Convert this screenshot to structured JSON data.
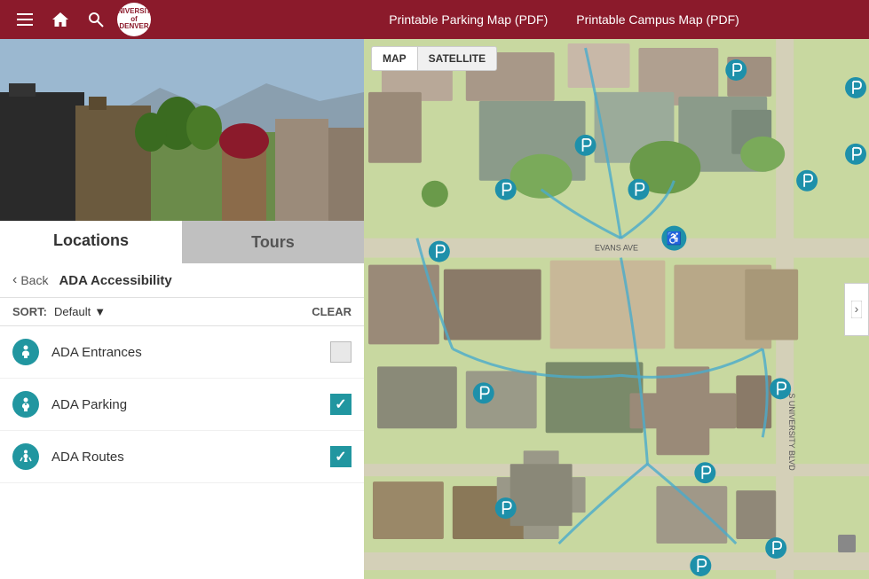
{
  "nav": {
    "menu_label": "Menu",
    "home_label": "Home",
    "search_label": "Search",
    "logo_line1": "UNIVERSITY",
    "logo_line2": "of",
    "logo_line3": "DENVER",
    "link1": "Printable Parking Map (PDF)",
    "link2": "Printable Campus Map (PDF)"
  },
  "sidebar": {
    "tab_locations": "Locations",
    "tab_tours": "Tours",
    "back_label": "Back",
    "section_title": "ADA Accessibility",
    "sort_label": "SORT:",
    "sort_value": "Default",
    "clear_label": "CLEAR"
  },
  "filters": [
    {
      "id": "ada-entrances",
      "label": "ADA Entrances",
      "icon_type": "entrance",
      "checked": false
    },
    {
      "id": "ada-parking",
      "label": "ADA Parking",
      "icon_type": "parking",
      "checked": true
    },
    {
      "id": "ada-routes",
      "label": "ADA Routes",
      "icon_type": "routes",
      "checked": true
    }
  ],
  "map": {
    "tab_map": "MAP",
    "tab_satellite": "SATELLITE"
  }
}
